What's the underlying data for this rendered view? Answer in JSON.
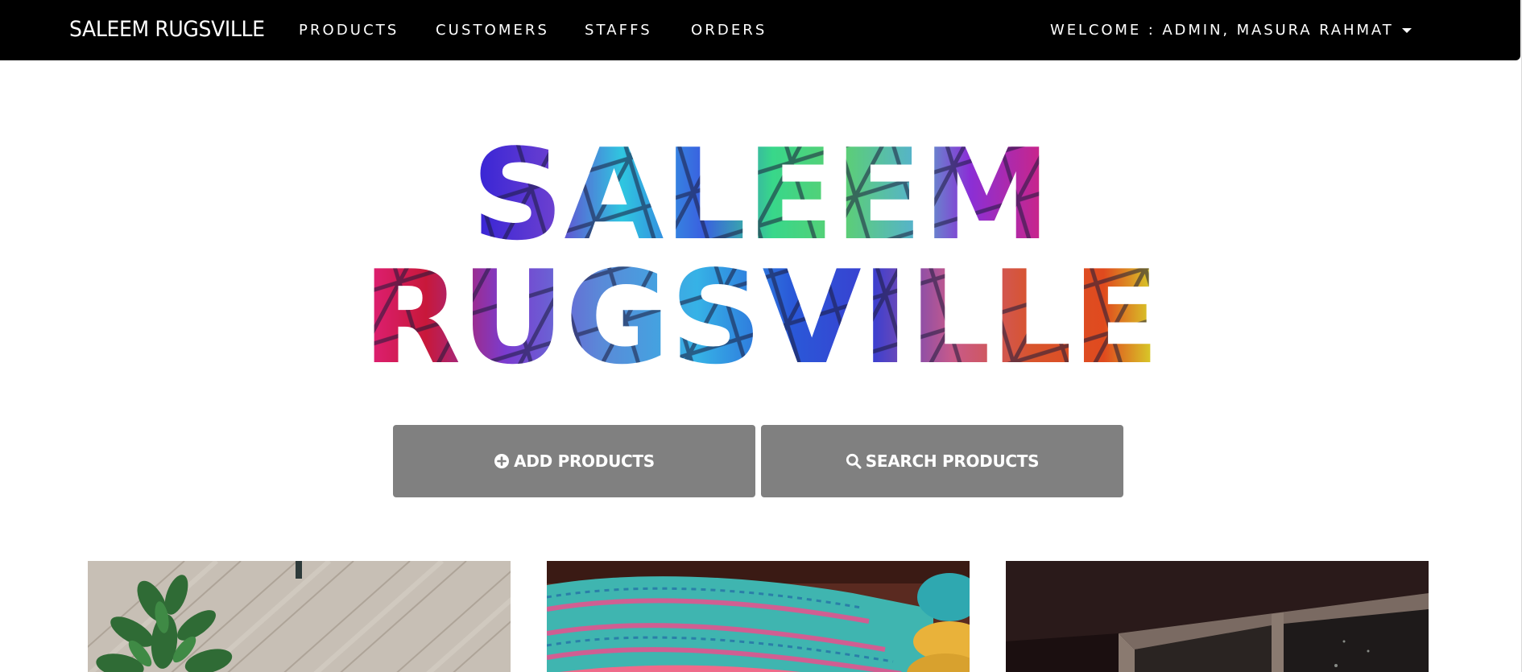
{
  "navbar": {
    "brand": "SALEEM RUGSVILLE",
    "links": [
      {
        "label": "PRODUCTS"
      },
      {
        "label": "CUSTOMERS"
      },
      {
        "label": "STAFFS"
      },
      {
        "label": "ORDERS"
      }
    ],
    "user_menu": {
      "label": "WELCOME : ADMIN, MASURA RAHMAT",
      "icon": "caret-down-icon"
    }
  },
  "hero": {
    "logo_line1": "SALEEM",
    "logo_line2": "RUGSVILLE"
  },
  "actions": {
    "add": {
      "label": "ADD PRODUCTS",
      "icon": "plus-circle-icon"
    },
    "search": {
      "label": "SEARCH PRODUCTS",
      "icon": "search-icon"
    },
    "button_color": "#808080"
  },
  "products": [
    {
      "image": "potted-plant-on-wood-floor"
    },
    {
      "image": "colorful-knitted-rugs"
    },
    {
      "image": "wooden-window-frame"
    }
  ],
  "colors": {
    "navbar_bg": "#000000",
    "navbar_text": "#ffffff",
    "page_bg": "#ffffff"
  }
}
